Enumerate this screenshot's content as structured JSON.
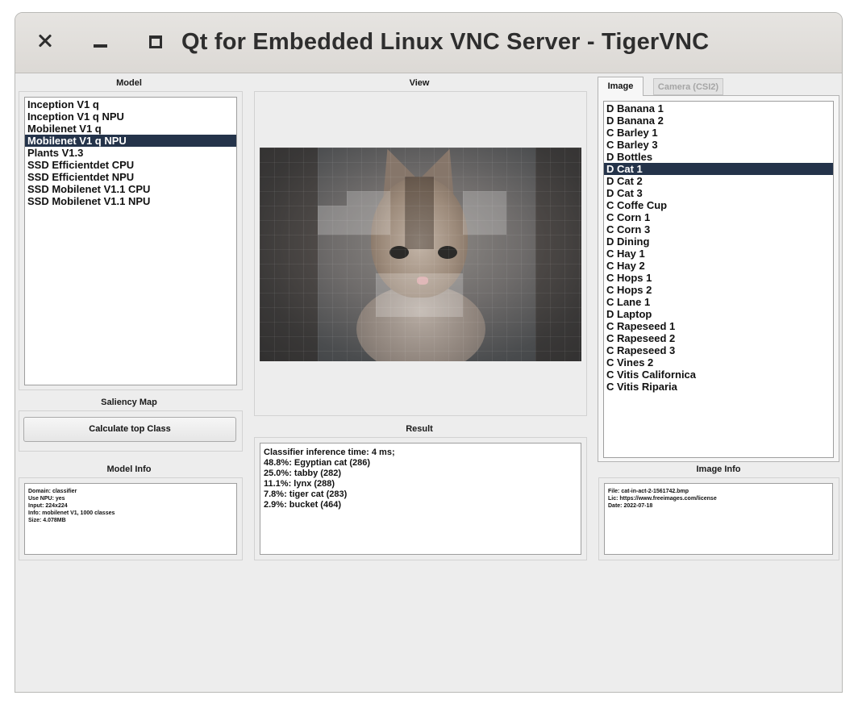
{
  "window": {
    "title": "Qt for Embedded Linux VNC Server - TigerVNC"
  },
  "model": {
    "label": "Model",
    "items": [
      "Inception V1 q",
      "Inception V1 q NPU",
      "Mobilenet V1 q",
      "Mobilenet V1 q NPU",
      "Plants V1.3",
      "SSD Efficientdet CPU",
      "SSD Efficientdet NPU",
      "SSD Mobilenet V1.1 CPU",
      "SSD Mobilenet V1.1 NPU"
    ],
    "selected": "Mobilenet V1 q NPU"
  },
  "view": {
    "label": "View"
  },
  "saliency": {
    "label": "Saliency Map",
    "button": "Calculate top Class"
  },
  "model_info": {
    "label": "Model Info",
    "lines": [
      "Domain: classifier",
      "Use NPU: yes",
      "Input: 224x224",
      "Info: mobilenet V1, 1000 classes",
      "Size: 4.078MB"
    ]
  },
  "result": {
    "label": "Result",
    "lines": [
      "Classifier inference time: 4 ms;",
      "48.8%: Egyptian cat (286)",
      "25.0%: tabby (282)",
      "11.1%: lynx (288)",
      "7.8%: tiger cat (283)",
      "2.9%: bucket (464)"
    ]
  },
  "tabs": {
    "image": "Image",
    "camera": "Camera (CSI2)"
  },
  "images": {
    "items": [
      "D Banana 1",
      "D Banana 2",
      "C Barley 1",
      "C Barley 3",
      "D Bottles",
      "D Cat 1",
      "D Cat 2",
      "D Cat 3",
      "C Coffe Cup",
      "C Corn 1",
      "C Corn 3",
      "D Dining",
      "C Hay 1",
      "C Hay 2",
      "C Hops 1",
      "C Hops 2",
      "C Lane 1",
      "D Laptop",
      "C Rapeseed 1",
      "C Rapeseed 2",
      "C Rapeseed 3",
      "C Vines 2",
      "C Vitis Californica",
      "C Vitis Riparia"
    ],
    "selected": "D Cat 1"
  },
  "image_info": {
    "label": "Image Info",
    "lines": [
      "File: cat-in-act-2-1561742.bmp",
      "Lic: https://www.freeimages.com/license",
      "Date: 2022-07-18"
    ]
  },
  "colors": {
    "selection": "#24334a",
    "background": "#ededed"
  }
}
